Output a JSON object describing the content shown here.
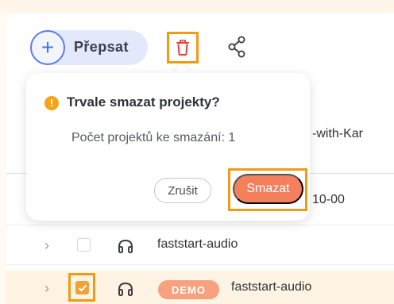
{
  "toolbar": {
    "rewrite_label": "Přepsat",
    "plus_symbol": "+",
    "icons": {
      "plus": "plus-circle-icon",
      "trash": "trash-icon",
      "share": "share-icon"
    },
    "accent_color": "#5b7de8",
    "highlight_color": "#f29a13"
  },
  "dialog": {
    "warning_symbol": "!",
    "title": "Trvale smazat projekty?",
    "body": "Počet projektů ke smazání: 1",
    "cancel_label": "Zrušit",
    "confirm_label": "Smazat",
    "confirm_color": "#f37f5c"
  },
  "table": {
    "partial_rows": [
      {
        "text": "-with-Kar"
      },
      {
        "text": "10-00"
      }
    ],
    "rows": [
      {
        "expand_symbol": "›",
        "checked": false,
        "icon": "headphones-icon",
        "badge": "",
        "name": "faststart-audio"
      },
      {
        "expand_symbol": "›",
        "checked": true,
        "icon": "headphones-icon",
        "badge": "DEMO",
        "name": "faststart-audio"
      }
    ]
  }
}
